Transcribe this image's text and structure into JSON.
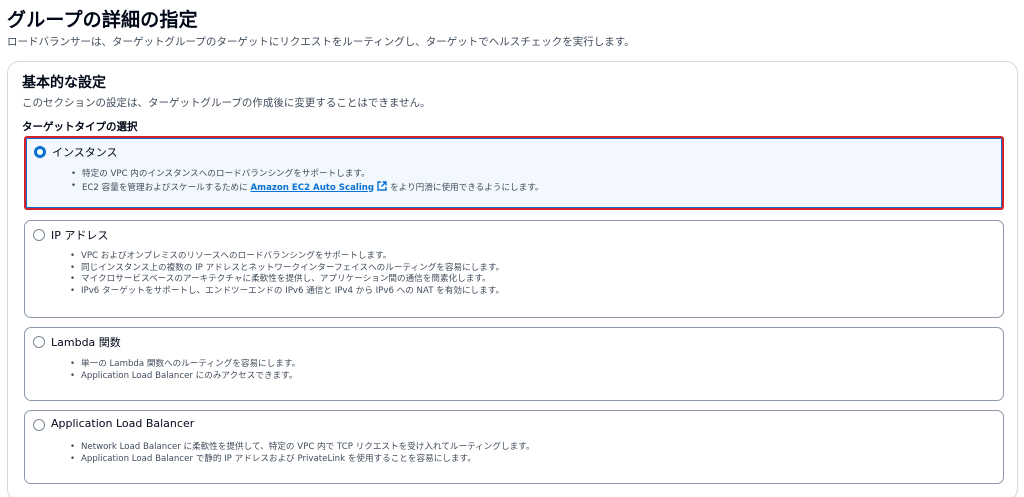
{
  "header": {
    "title": "グループの詳細の指定",
    "description": "ロードバランサーは、ターゲットグループのターゲットにリクエストをルーティングし、ターゲットでヘルスチェックを実行します。"
  },
  "section": {
    "title": "基本的な設定",
    "description": "このセクションの設定は、ターゲットグループの作成後に変更することはできません。",
    "group_label": "ターゲットタイプの選択"
  },
  "options": [
    {
      "title": "インスタンス",
      "selected": true,
      "bullets": [
        "特定の VPC 内のインスタンスへのロードバランシングをサポートします。"
      ],
      "bullet2_before": "EC2 容量を管理およびスケールするために",
      "bullet2_link": "Amazon EC2 Auto Scaling",
      "bullet2_after": "をより円滑に使用できるようにします。"
    },
    {
      "title": "IP アドレス",
      "selected": false,
      "bullets": [
        "VPC およびオンプレミスのリソースへのロードバランシングをサポートします。",
        "同じインスタンス上の複数の IP アドレスとネットワークインターフェイスへのルーティングを容易にします。",
        "マイクロサービスベースのアーキテクチャに柔軟性を提供し、アプリケーション間の通信を簡素化します。",
        "IPv6 ターゲットをサポートし、エンドツーエンドの IPv6 通信と IPv4 から IPv6 への NAT を有効にします。"
      ]
    },
    {
      "title": "Lambda 関数",
      "selected": false,
      "bullets": [
        "単一の Lambda 関数へのルーティングを容易にします。",
        "Application Load Balancer にのみアクセスできます。"
      ]
    },
    {
      "title": "Application Load Balancer",
      "selected": false,
      "bullets": [
        "Network Load Balancer に柔軟性を提供して、特定の VPC 内で TCP リクエストを受け入れてルーティングします。",
        "Application Load Balancer で静的 IP アドレスおよび PrivateLink を使用することを容易にします。"
      ]
    }
  ],
  "colors": {
    "accent": "#0972d3",
    "highlight_border": "#d6222b",
    "selected_bg": "#f2f8fd"
  }
}
